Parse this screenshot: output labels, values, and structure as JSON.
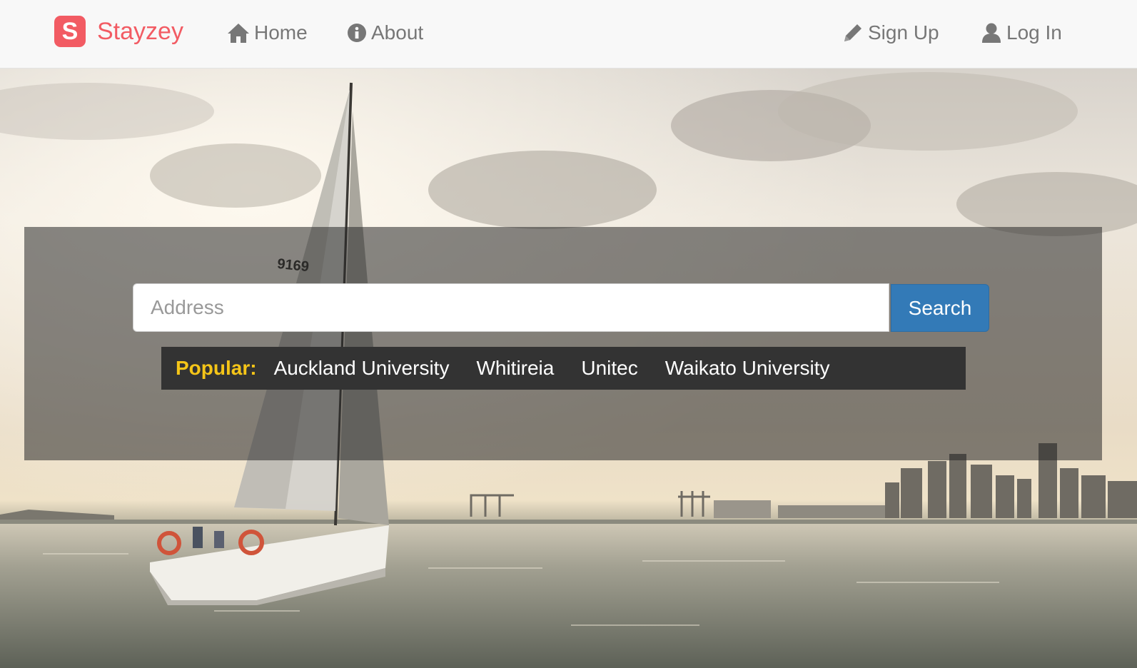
{
  "brand": {
    "logo_letter": "S",
    "name": "Stayzey",
    "color": "#f25b63"
  },
  "nav": {
    "home_label": "Home",
    "about_label": "About",
    "signup_label": "Sign Up",
    "login_label": "Log In"
  },
  "search": {
    "placeholder": "Address",
    "button_label": "Search",
    "button_color": "#337ab7"
  },
  "popular": {
    "label": "Popular:",
    "label_color": "#f5c518",
    "items": [
      {
        "label": "Auckland University"
      },
      {
        "label": "Whitireia"
      },
      {
        "label": "Unitec"
      },
      {
        "label": "Waikato University"
      }
    ]
  },
  "hero": {
    "sail_number": "9169"
  },
  "icons": [
    "home-icon",
    "info-icon",
    "pencil-icon",
    "user-icon"
  ]
}
